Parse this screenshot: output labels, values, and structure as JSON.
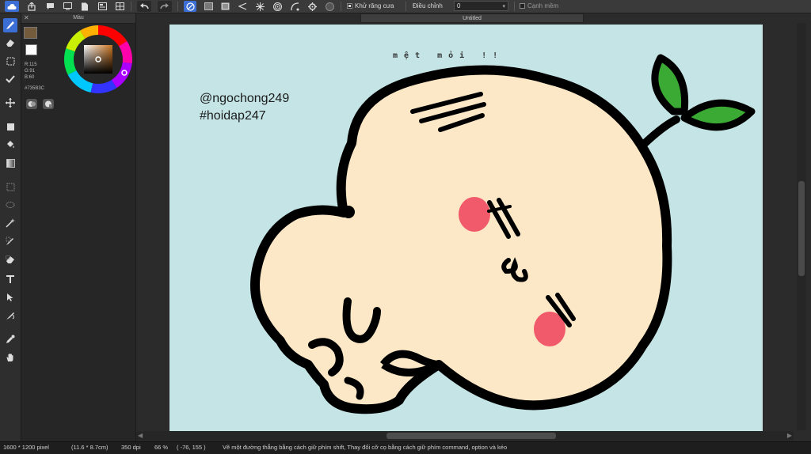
{
  "toolbar": {
    "antialias_label": "Khử răng cưa",
    "antialias_checked": true,
    "adjust_label": "Điều chỉnh",
    "adjust_value": "0",
    "soft_edge_label": "Cạnh mềm",
    "soft_edge_checked": false
  },
  "document": {
    "tab_title": "Untitled"
  },
  "color_panel": {
    "title": "Màu",
    "r_label": "R:115",
    "g_label": "G:91",
    "b_label": "B:60",
    "hex_label": "#735B3C",
    "primary_color": "#735B3C",
    "secondary_color": "#FFFFFF"
  },
  "canvas": {
    "watermark_line1": "@ngochong249",
    "watermark_line2": "#hoidap247",
    "caption": "mệt mỏi !!",
    "background_color": "#C4E4E6",
    "face_color": "#FCE8C6",
    "cheek_color": "#F05A6A",
    "leaf_color": "#3BAA35"
  },
  "status": {
    "pixel_size": "1600 * 1200 pixel",
    "cm_size": "(11.6 * 8.7cm)",
    "dpi": "350 dpi",
    "zoom": "66 %",
    "cursor": "( -76, 155 )",
    "hint": "Vẽ một đường thẳng bằng cách giữ phím shift, Thay đổi cỡ cọ bằng cách giữ phím command, option và kéo"
  }
}
